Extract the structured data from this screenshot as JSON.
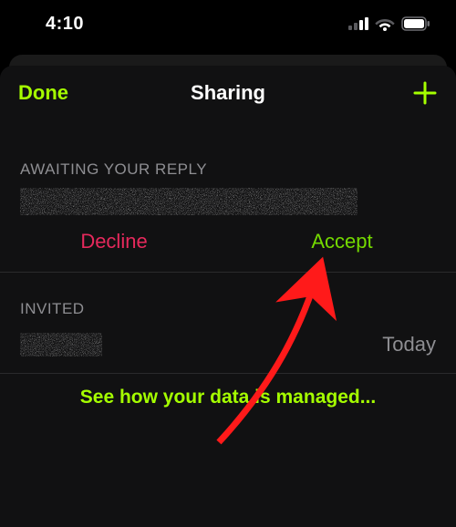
{
  "status": {
    "time": "4:10"
  },
  "nav": {
    "done": "Done",
    "title": "Sharing"
  },
  "awaiting": {
    "header": "AWAITING YOUR REPLY",
    "decline": "Decline",
    "accept": "Accept"
  },
  "invited": {
    "header": "INVITED",
    "when": "Today"
  },
  "footer": {
    "link": "See how your data is managed..."
  },
  "colors": {
    "accent": "#a5ff00",
    "destructive": "#e6295c"
  }
}
